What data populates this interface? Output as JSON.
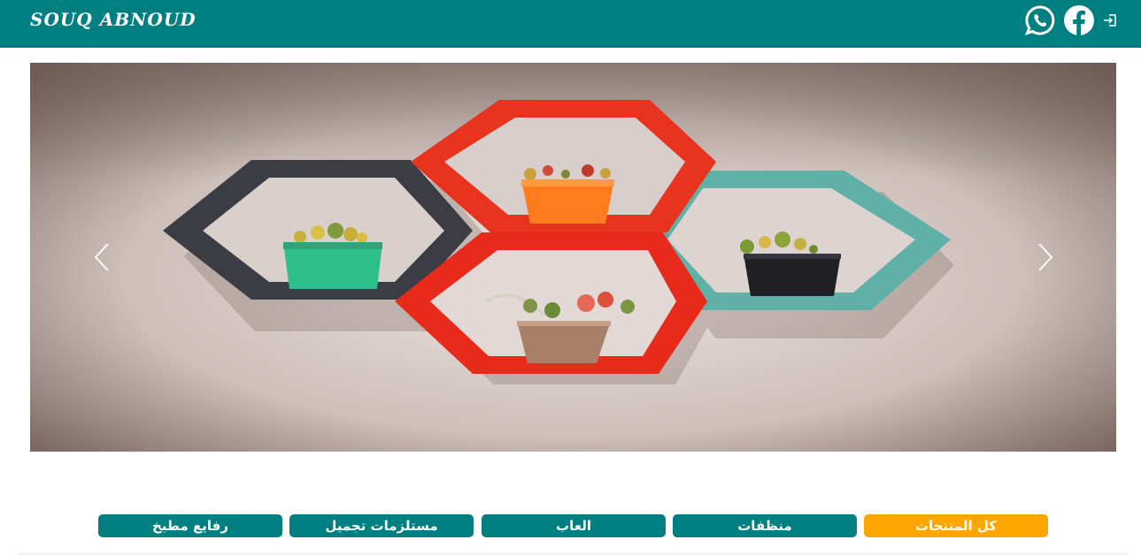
{
  "header": {
    "brand": "SOUQ ABNOUD",
    "background_color": "#007f80",
    "icons": [
      "whatsapp-icon",
      "facebook-icon",
      "login-icon"
    ]
  },
  "carousel": {
    "prev_icon": "chevron-left-icon",
    "next_icon": "chevron-right-icon"
  },
  "categories": {
    "items": [
      {
        "label": "كل المنتجات",
        "active": true
      },
      {
        "label": "منظفات",
        "active": false
      },
      {
        "label": "العاب",
        "active": false
      },
      {
        "label": "مستلزمات تجميل",
        "active": false
      },
      {
        "label": "رفايع مطبخ",
        "active": false
      }
    ],
    "active_color": "#ffa500",
    "inactive_color": "#007f80"
  }
}
